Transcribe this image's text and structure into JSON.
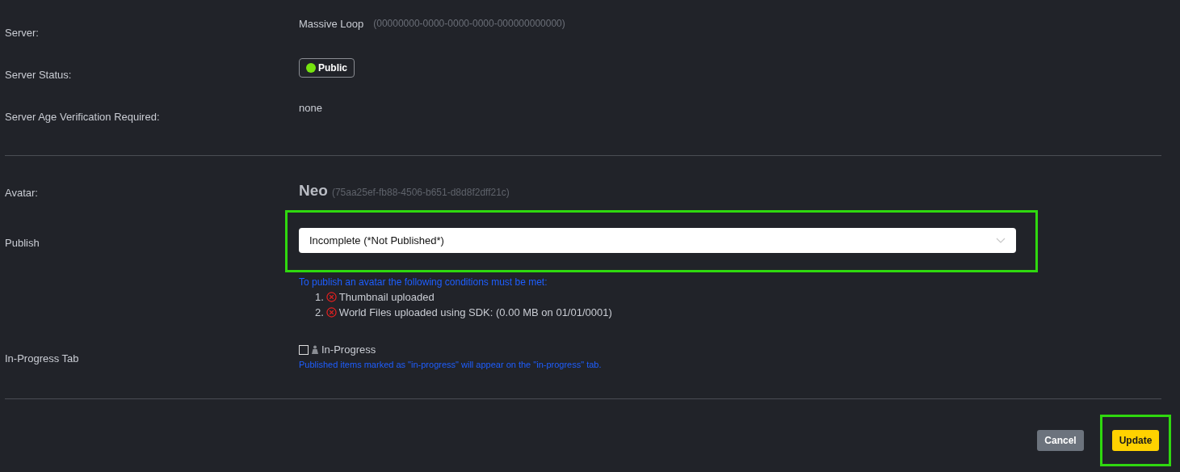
{
  "server": {
    "label": "Server:",
    "name": "Massive Loop",
    "id": "(00000000-0000-0000-0000-000000000000)"
  },
  "server_status": {
    "label": "Server Status:",
    "badge": "Public",
    "color": "#76e40f"
  },
  "age_verification": {
    "label": "Server Age Verification Required:",
    "value": "none"
  },
  "avatar": {
    "label": "Avatar:",
    "name": "Neo",
    "id": "(75aa25ef-fb88-4506-b651-d8d8f2dff21c)"
  },
  "publish": {
    "label": "Publish",
    "value": "Incomplete (*Not Published*)",
    "highlighted": true,
    "note": "To publish an avatar the following conditions must be met:",
    "conditions": [
      {
        "number": "1.",
        "text": "Thumbnail uploaded",
        "met": false
      },
      {
        "number": "2.",
        "text": "World Files uploaded using SDK: (0.00 MB on 01/01/0001)",
        "met": false
      }
    ]
  },
  "in_progress": {
    "label": "In-Progress Tab",
    "checkbox_label": "In-Progress",
    "checked": false,
    "help": "Published items marked as \"in-progress\" will appear on the \"in-progress\" tab."
  },
  "buttons": [
    {
      "label": "Cancel",
      "kind": "secondary",
      "highlighted": false
    },
    {
      "label": "Update",
      "kind": "primary",
      "highlighted": true
    }
  ]
}
